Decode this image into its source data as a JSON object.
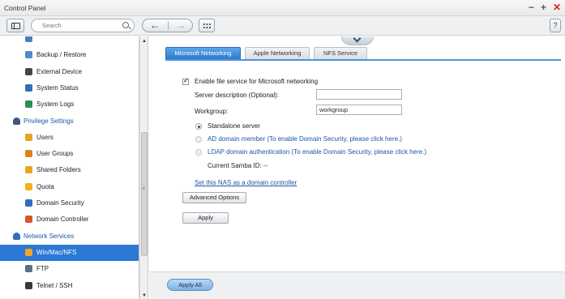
{
  "window": {
    "title": "Control Panel",
    "controls": {
      "minimize": "−",
      "maximize": "+",
      "close": "✕"
    }
  },
  "toolbar": {
    "search_placeholder": "Search",
    "back_arrow": "←",
    "forward_arrow": "→",
    "help_label": "?"
  },
  "sidebar": {
    "items": [
      {
        "label": "",
        "type": "sub",
        "icon": "system-icon",
        "color": "#4e7fbf"
      },
      {
        "label": "Backup / Restore",
        "type": "sub",
        "icon": "backup-icon",
        "color": "#5588c8"
      },
      {
        "label": "External Device",
        "type": "sub",
        "icon": "external-device-icon",
        "color": "#444444"
      },
      {
        "label": "System Status",
        "type": "sub",
        "icon": "system-status-icon",
        "color": "#2e6fb8"
      },
      {
        "label": "System Logs",
        "type": "sub",
        "icon": "system-logs-icon",
        "color": "#2a8f55"
      },
      {
        "label": "Privilege Settings",
        "type": "group",
        "icon": "person-icon",
        "color": "#3d5a80"
      },
      {
        "label": "Users",
        "type": "sub",
        "icon": "user-icon",
        "color": "#e7a325"
      },
      {
        "label": "User Groups",
        "type": "sub",
        "icon": "user-groups-icon",
        "color": "#d9831f"
      },
      {
        "label": "Shared Folders",
        "type": "sub",
        "icon": "shared-folder-icon",
        "color": "#e8a51c"
      },
      {
        "label": "Quota",
        "type": "sub",
        "icon": "quota-icon",
        "color": "#f2b21b"
      },
      {
        "label": "Domain Security",
        "type": "sub",
        "icon": "domain-security-icon",
        "color": "#2f6fbd"
      },
      {
        "label": "Domain Controller",
        "type": "sub",
        "icon": "domain-controller-icon",
        "color": "#d9542b"
      },
      {
        "label": "Network Services",
        "type": "group",
        "icon": "globe-icon",
        "color": "#2f6fbd"
      },
      {
        "label": "Win/Mac/NFS",
        "type": "sub",
        "icon": "win-mac-nfs-icon",
        "color": "#f0a425",
        "selected": true
      },
      {
        "label": "FTP",
        "type": "sub",
        "icon": "ftp-icon",
        "color": "#5a6f8a"
      },
      {
        "label": "Telnet / SSH",
        "type": "sub",
        "icon": "telnet-ssh-icon",
        "color": "#3a3a3a"
      }
    ]
  },
  "tabs": [
    {
      "label": "Microsoft Networking",
      "active": true
    },
    {
      "label": "Apple Networking",
      "active": false
    },
    {
      "label": "NFS Service",
      "active": false
    }
  ],
  "ms_networking": {
    "enable_label": "Enable file service for Microsoft networking",
    "enable_checked": true,
    "server_desc_label": "Server description (Optional):",
    "server_desc_value": "",
    "workgroup_label": "Workgroup:",
    "workgroup_value": "workgroup",
    "radio_standalone": "Standalone server",
    "radio_ad": "AD domain member (To enable Domain Security, please click here.)",
    "radio_ldap": "LDAP domain authentication (To enable Domain Security, please click here.)",
    "samba_id_label": "Current Samba ID: --",
    "set_dc_link": "Set this NAS as a domain controller",
    "advanced_options_label": "Advanced Options",
    "apply_label": "Apply"
  },
  "footer": {
    "apply_all_label": "Apply All"
  }
}
